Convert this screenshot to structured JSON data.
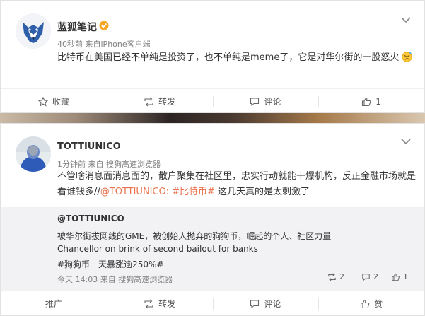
{
  "post1": {
    "author": "蓝狐笔记",
    "time": "40秒前",
    "via": "来自",
    "client": "iPhone客户端",
    "text": "比特币在美国已经不单纯是投资了，也不单纯是meme了，它是对华尔街的一股怒火",
    "actions": {
      "collect": "收藏",
      "repost": "转发",
      "comment": "评论",
      "like": "1"
    }
  },
  "post2": {
    "author": "TOTTIUNICO",
    "time": "1分钟前",
    "via": "来自",
    "client": "搜狗高速浏览器",
    "text_part1": "不管啥消息面消息面的，散户聚集在社区里，忠实行动就能干爆机构，反正金融市场就是看谁钱多//",
    "mention": "@TOTTIUNICO:",
    "hashtag": "#比特币#",
    "text_part2": " 这几天真的是太刺激了",
    "repost": {
      "author": "@TOTTIUNICO",
      "line1": "被华尔街拔网线的GME，被创始人抛弃的狗狗币，崛起的个人、社区力量",
      "line2": "Chancellor on brink of second bailout for banks",
      "hashtag": "#狗狗币一天暴涨逾250%#",
      "time": "今天 14:03",
      "via": "来自",
      "client": "搜狗高速浏览器",
      "repost_count": "2",
      "comment_count": "2",
      "like_count": "1"
    },
    "actions": {
      "promote": "推广",
      "repost": "转发",
      "comment": "评论",
      "like": "赞"
    }
  },
  "colors": {
    "link": "#eb7350",
    "verified": "#f5a623"
  }
}
